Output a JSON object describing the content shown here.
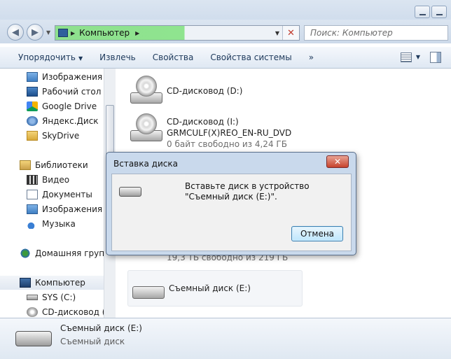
{
  "address": {
    "location": "Компьютер",
    "search_placeholder": "Поиск: Компьютер"
  },
  "toolbar": {
    "organize": "Упорядочить",
    "eject": "Извлечь",
    "properties": "Свойства",
    "system_properties": "Свойства системы",
    "more": "»"
  },
  "nav": {
    "items": [
      {
        "label": "Изображения",
        "icon": "pictures-icon"
      },
      {
        "label": "Рабочий стол",
        "icon": "desktop-icon"
      },
      {
        "label": "Google Drive",
        "icon": "google-drive-icon"
      },
      {
        "label": "Яндекс.Диск",
        "icon": "yandex-disk-icon"
      },
      {
        "label": "SkyDrive",
        "icon": "folder-icon"
      },
      {
        "label": "Библиотеки",
        "icon": "libraries-icon"
      },
      {
        "label": "Видео",
        "icon": "video-icon"
      },
      {
        "label": "Документы",
        "icon": "documents-icon"
      },
      {
        "label": "Изображения",
        "icon": "pictures-icon"
      },
      {
        "label": "Музыка",
        "icon": "music-icon"
      },
      {
        "label": "Домашняя группа",
        "icon": "homegroup-icon"
      },
      {
        "label": "Компьютер",
        "icon": "computer-icon"
      },
      {
        "label": "SYS (C:)",
        "icon": "hard-drive-icon"
      },
      {
        "label": "CD-дисковод (D:",
        "icon": "cd-drive-icon"
      }
    ]
  },
  "content": {
    "drives": [
      {
        "name": "CD-дисковод (D:)"
      },
      {
        "name": "CD-дисковод (I:)",
        "label": "GRMCULF(X)REO_EN-RU_DVD",
        "free": "0 байт свободно из 4,24 ГБ"
      },
      {
        "free": "19,3 ТБ свободно из 219 ГБ"
      },
      {
        "name": "Съемный диск (E:)"
      }
    ]
  },
  "details": {
    "name": "Съемный диск (E:)",
    "type": "Съемный диск"
  },
  "dialog": {
    "title": "Вставка диска",
    "message": "Вставьте диск в устройство \"Съемный диск (E:)\".",
    "cancel": "Отмена",
    "close": "✕"
  },
  "colors": {
    "address_progress": "#8ee08e",
    "close_button": "#c7432d",
    "dialog_frame": "#c9d9ec"
  }
}
